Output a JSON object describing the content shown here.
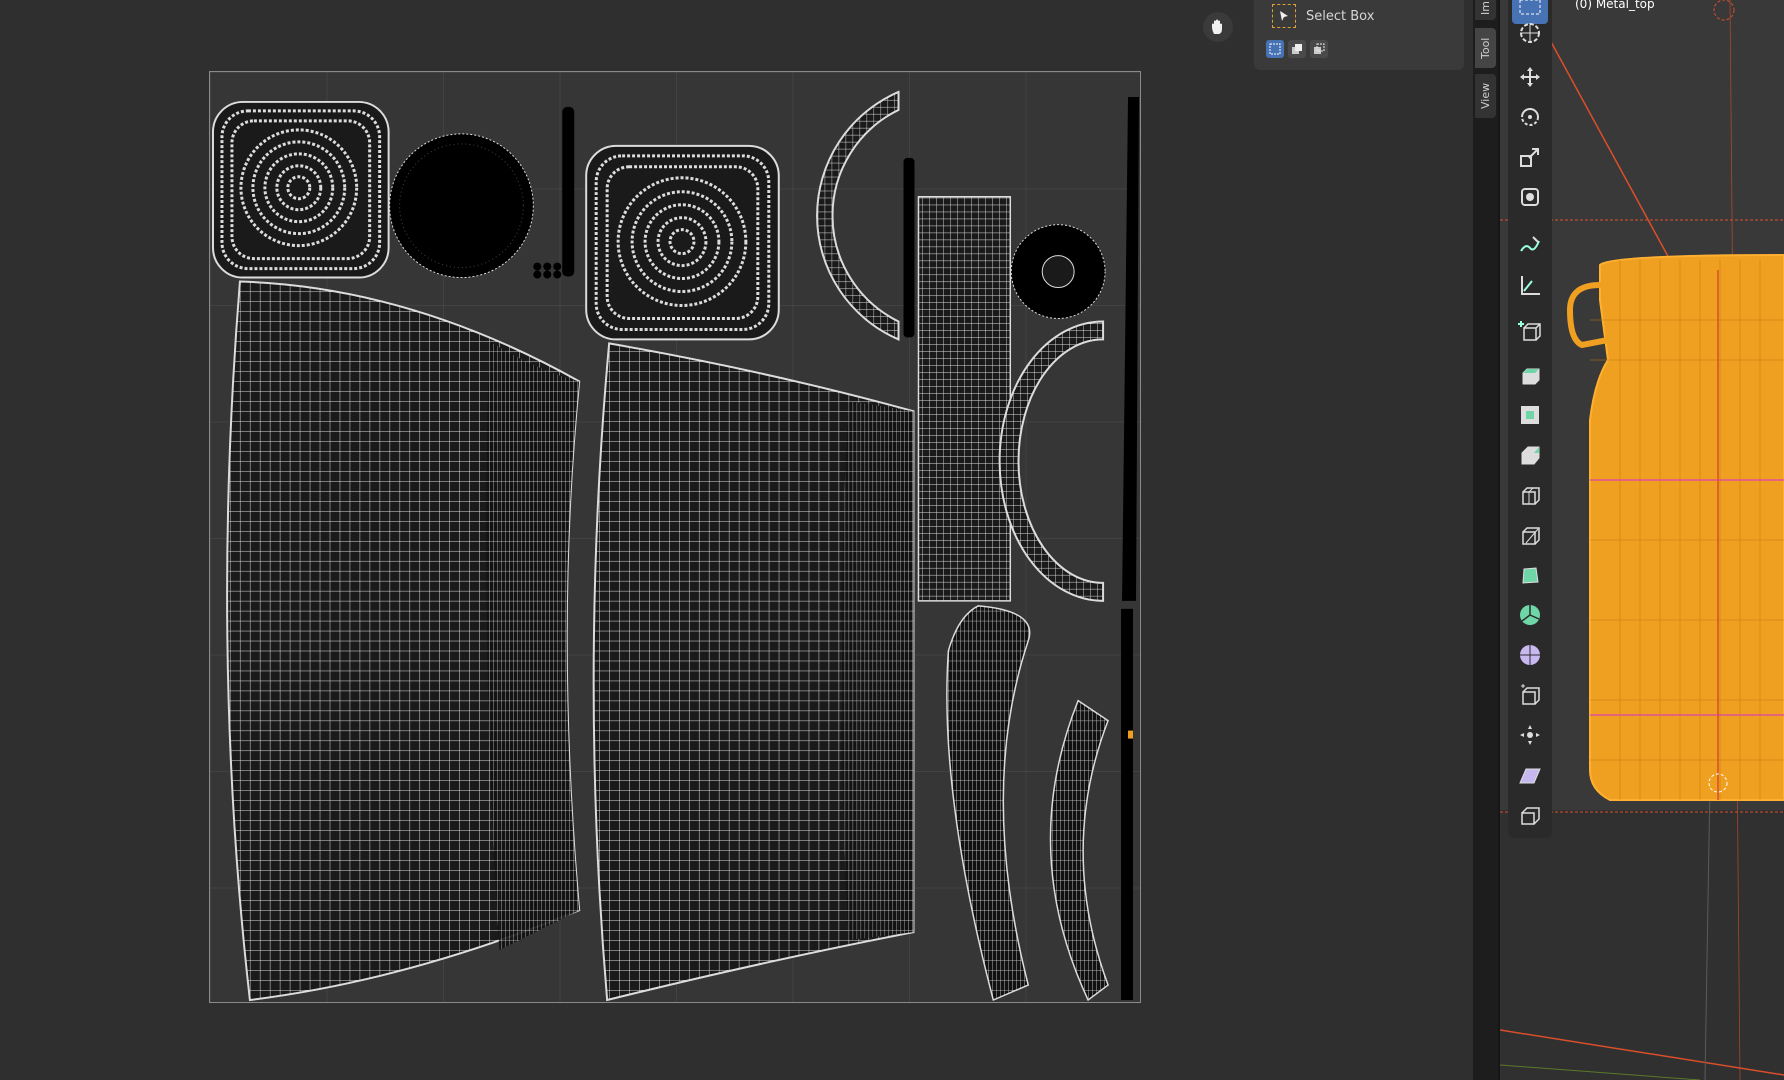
{
  "tool_panel": {
    "tool_name": "Select Box",
    "modes": [
      "set-mode-icon",
      "extend-mode-icon",
      "subtract-mode-icon"
    ],
    "active_mode": 0
  },
  "side_tabs": [
    "Im",
    "Tool",
    "View"
  ],
  "viewport": {
    "object_name": "(0) Metal_top"
  },
  "toolbar": {
    "tools": [
      "select-box-icon",
      "cursor-icon",
      "move-icon",
      "rotate-icon",
      "scale-icon",
      "transform-icon",
      "annotate-icon",
      "measure-icon",
      "add-cube-icon",
      "extrude-icon",
      "inset-icon",
      "bevel-icon",
      "loop-cut-icon",
      "knife-icon",
      "poly-build-icon",
      "spin-icon",
      "smooth-icon",
      "edge-slide-icon",
      "shrink-fatten-icon",
      "shear-icon",
      "rip-icon"
    ],
    "active_tool": 0
  },
  "colors": {
    "uv_background": "#363636",
    "uv_lines": "#dcdcdc",
    "active_blue": "#4772b3",
    "object_orange": "#f0a020",
    "wire_red": "#d94f2a",
    "seam_pink": "#e0509a"
  }
}
